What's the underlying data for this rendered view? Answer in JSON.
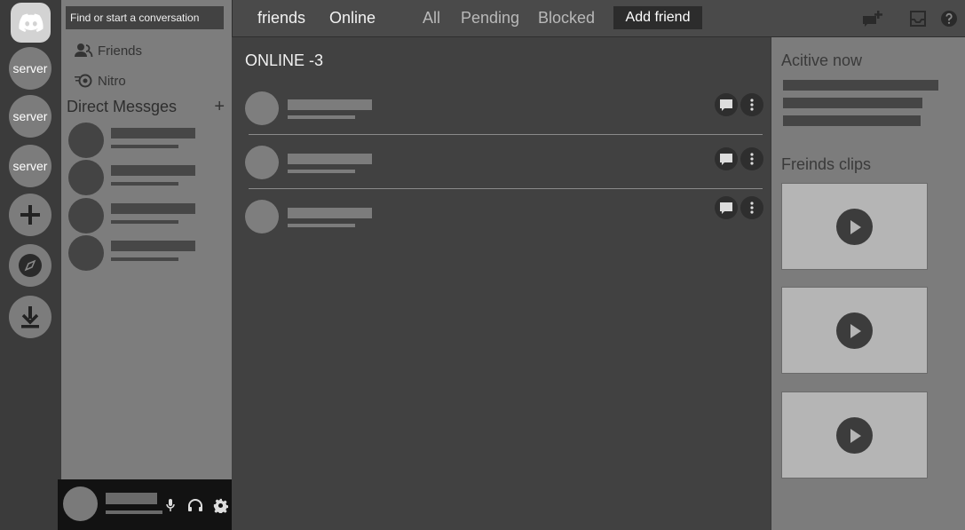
{
  "rail": {
    "servers": [
      {
        "label": "server"
      },
      {
        "label": "server"
      },
      {
        "label": "server"
      }
    ]
  },
  "sidebar": {
    "search_placeholder": "Find or start a conversation",
    "friends_label": "Friends",
    "nitro_label": "Nitro",
    "dm_heading": "Direct Messges",
    "dm_add": "+"
  },
  "topbar": {
    "friends": "friends",
    "online": "Online",
    "all": "All",
    "pending": "Pending",
    "blocked": "Blocked",
    "add_friend": "Add friend"
  },
  "main": {
    "online_title": "ONLINE -3"
  },
  "right": {
    "active_title": "Acitive now",
    "clips_title": "Freinds clips"
  },
  "colors": {
    "background": "#414141",
    "sidebar": "#7d7d7d",
    "rail": "#3b3b3b",
    "user_panel": "#121212"
  },
  "icons": [
    "discord-logo-icon",
    "plus-icon",
    "compass-icon",
    "download-icon",
    "friends-icon",
    "nitro-icon",
    "mic-icon",
    "headphones-icon",
    "gear-icon",
    "new-group-dm-icon",
    "inbox-icon",
    "help-icon",
    "chat-bubble-icon",
    "more-vertical-icon",
    "play-icon"
  ]
}
